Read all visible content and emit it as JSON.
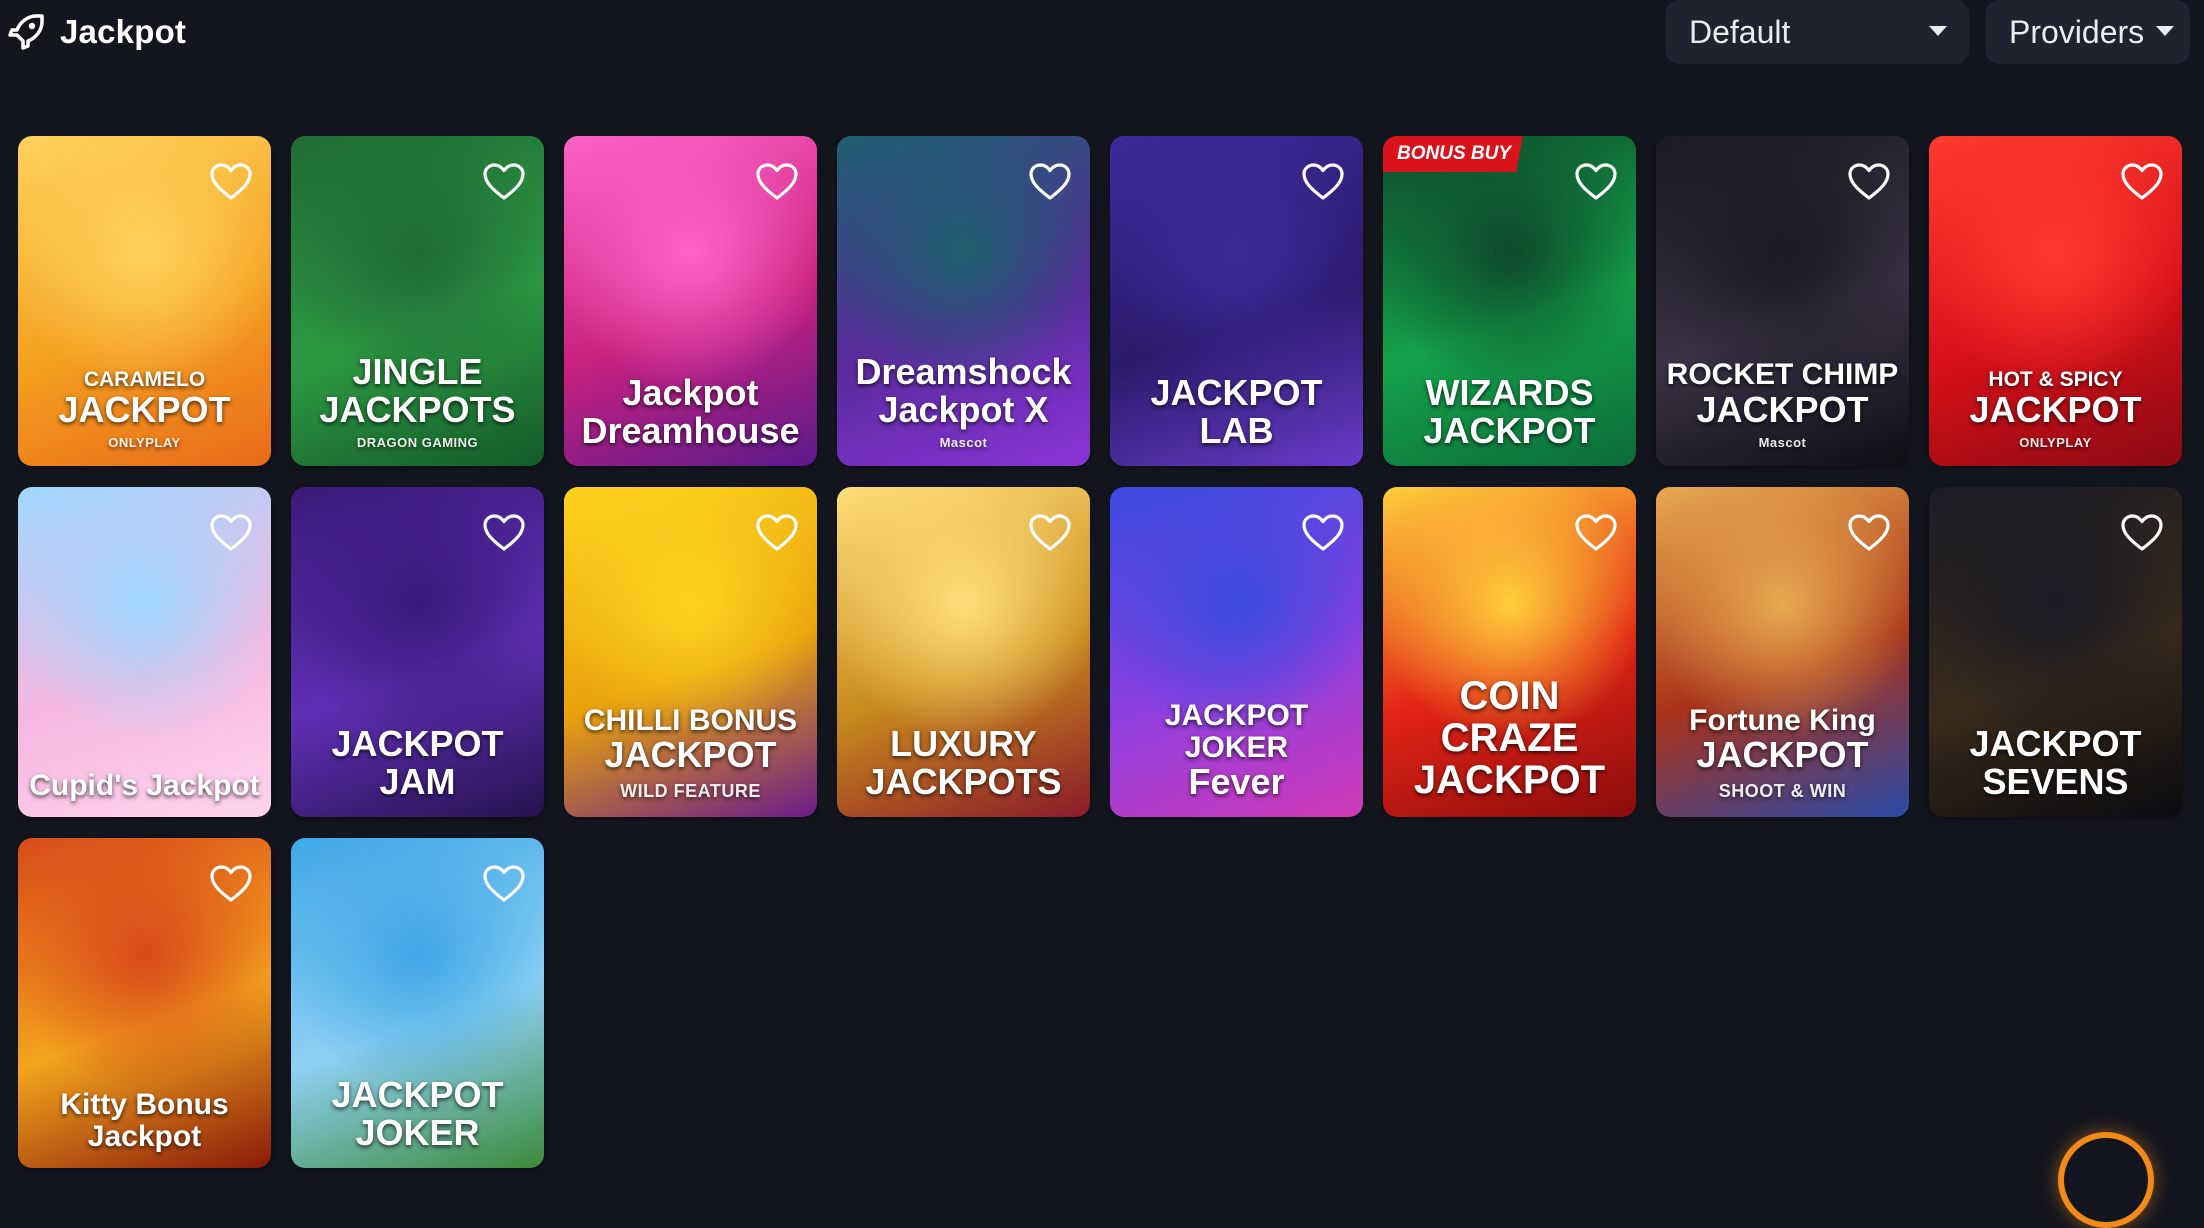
{
  "header": {
    "title": "Jackpot",
    "icon": "rocket-icon",
    "sort_select": "Default",
    "providers_button": "Providers"
  },
  "games": [
    {
      "id": "caramelo-jackpot",
      "lines": [
        "CARAMELO",
        "JACKPOT"
      ],
      "provider": "ONLYPLAY",
      "colors": [
        "#ffd25c",
        "#f4a11f",
        "#e96a1a"
      ]
    },
    {
      "id": "jingle-jackpots",
      "lines": [
        "JINGLE",
        "JACKPOTS"
      ],
      "provider": "DRAGON GAMING",
      "colors": [
        "#1f6b35",
        "#2d9a42",
        "#145a2a"
      ]
    },
    {
      "id": "jackpot-dreamhouse",
      "lines": [
        "Jackpot",
        "Dreamhouse"
      ],
      "provider": "",
      "colors": [
        "#ff63c8",
        "#c9217f",
        "#5b1a8c"
      ]
    },
    {
      "id": "dreamshock-jackpot-x",
      "lines": [
        "Dreamshock",
        "Jackpot X"
      ],
      "provider": "Mascot",
      "colors": [
        "#1e6070",
        "#5a2a9c",
        "#8a35d8"
      ]
    },
    {
      "id": "jackpot-lab",
      "lines": [
        "JACKPOT",
        "LAB"
      ],
      "provider": "",
      "colors": [
        "#3e2a9a",
        "#2a1a6b",
        "#6a3bc9"
      ]
    },
    {
      "id": "wizards-jackpot",
      "lines": [
        "WIZARDS",
        "JACKPOT"
      ],
      "provider": "",
      "badge": "BONUS BUY",
      "colors": [
        "#0e4a2b",
        "#14a24a",
        "#0d6b3a"
      ]
    },
    {
      "id": "rocket-chimp-jackpot",
      "lines": [
        "ROCKET CHIMP",
        "JACKPOT"
      ],
      "provider": "Mascot",
      "colors": [
        "#1a1a24",
        "#3a3246",
        "#0e0e14"
      ]
    },
    {
      "id": "hot-spicy-jackpot",
      "lines": [
        "HOT & SPICY",
        "JACKPOT"
      ],
      "provider": "ONLYPLAY",
      "colors": [
        "#ff3b2e",
        "#d8101a",
        "#8b0a12"
      ]
    },
    {
      "id": "cupids-jackpot",
      "lines": [
        "Cupid's Jackpot"
      ],
      "provider": "",
      "colors": [
        "#9fd7ff",
        "#f5b7e0",
        "#ffd4ee"
      ]
    },
    {
      "id": "jackpot-jam",
      "lines": [
        "JACKPOT",
        "JAM"
      ],
      "provider": "",
      "colors": [
        "#3a1a7a",
        "#5f2fb5",
        "#27124f"
      ]
    },
    {
      "id": "chilli-bonus-jackpot",
      "lines": [
        "CHILLI BONUS",
        "JACKPOT"
      ],
      "provider": "",
      "footer": "WILD FEATURE",
      "colors": [
        "#ffd21f",
        "#e8a10c",
        "#6a1c8a"
      ]
    },
    {
      "id": "luxury-jackpots",
      "lines": [
        "LUXURY",
        "JACKPOTS"
      ],
      "provider": "",
      "colors": [
        "#ffdf7a",
        "#c98a1d",
        "#8a1a2a"
      ]
    },
    {
      "id": "jackpot-joker-fever",
      "lines": [
        "JACKPOT JOKER",
        "Fever"
      ],
      "provider": "",
      "colors": [
        "#3a4be0",
        "#8d3fe0",
        "#d13ab8"
      ]
    },
    {
      "id": "coin-craze-jackpot",
      "lines": [
        "COIN",
        "CRAZE",
        "JACKPOT"
      ],
      "provider": "",
      "colors": [
        "#ffcf3a",
        "#e22416",
        "#8a0c0c"
      ]
    },
    {
      "id": "fortune-king-jackpot",
      "lines": [
        "Fortune King",
        "JACKPOT"
      ],
      "provider": "",
      "footer": "SHOOT & WIN",
      "colors": [
        "#e8a94f",
        "#a8321a",
        "#2a4aa8"
      ]
    },
    {
      "id": "jackpot-sevens",
      "lines": [
        "JACKPOT",
        "SEVENS"
      ],
      "provider": "",
      "colors": [
        "#1a1c26",
        "#3a2a1a",
        "#0a0b10"
      ]
    },
    {
      "id": "kitty-bonus-jackpot",
      "lines": [
        "Kitty Bonus Jackpot"
      ],
      "provider": "",
      "colors": [
        "#d94a1a",
        "#f3a41d",
        "#8a1a0a"
      ]
    },
    {
      "id": "jackpot-joker",
      "lines": [
        "JACKPOT",
        "JOKER"
      ],
      "provider": "",
      "colors": [
        "#3fa7e6",
        "#8fd1f5",
        "#3d8a3a"
      ]
    }
  ],
  "icons": {
    "favorite": "heart-outline-icon",
    "loader": "loading-spinner-icon"
  }
}
